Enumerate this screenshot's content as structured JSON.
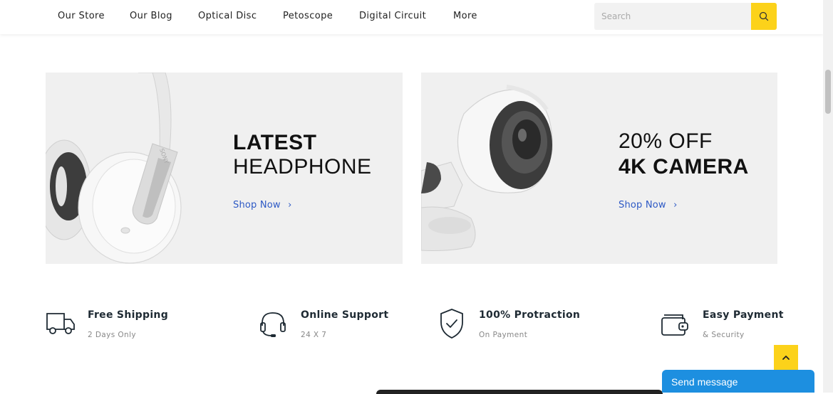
{
  "nav": {
    "items": [
      "Our Store",
      "Our Blog",
      "Optical Disc",
      "Petoscope",
      "Digital Circuit",
      "More"
    ],
    "search_placeholder": "Search"
  },
  "banners": {
    "left": {
      "line1": "LATEST",
      "line2": "HEADPHONE",
      "link": "Shop Now"
    },
    "right": {
      "line1": "20% OFF",
      "line2": "4K CAMERA",
      "link": "Shop Now"
    }
  },
  "features": [
    {
      "title": "Free Shipping",
      "subtitle": "2 Days Only",
      "icon": "truck-icon"
    },
    {
      "title": "Online Support",
      "subtitle": "24 X 7",
      "icon": "headset-icon"
    },
    {
      "title": "100% Protraction",
      "subtitle": "On Payment",
      "icon": "shield-check-icon"
    },
    {
      "title": "Easy Payment",
      "subtitle": "& Security",
      "icon": "wallet-icon"
    }
  ],
  "chat": {
    "label": "Send message"
  },
  "colors": {
    "accent": "#fcd21a",
    "link": "#2d59c5",
    "chat": "#1d8fe0",
    "banner_bg": "#f0f0f0"
  }
}
